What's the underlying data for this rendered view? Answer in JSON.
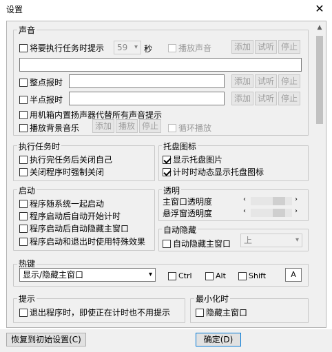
{
  "window": {
    "title": "设置",
    "close_glyph": "✕"
  },
  "sound": {
    "title": "声音",
    "task_prompt_label": "将要执行任务时提示",
    "task_prompt_seconds": "59",
    "seconds_unit": "秒",
    "play_sound_label": "播放声音",
    "add": "添加",
    "listen": "试听",
    "stop": "停止",
    "on_hour_label": "整点报时",
    "half_hour_label": "半点报时",
    "internal_speaker_label": "用机箱内置扬声器代替所有声音提示",
    "bg_music_label": "播放背景音乐",
    "play": "播放",
    "loop_label": "循环播放"
  },
  "task": {
    "title": "执行任务时",
    "close_self_label": "执行完任务后关闭自己",
    "force_close_label": "关闭程序时强制关闭"
  },
  "tray": {
    "title": "托盘图标",
    "show_tray_label": "显示托盘图片",
    "dynamic_tray_label": "计时时动态显示托盘图标"
  },
  "startup": {
    "title": "启动",
    "with_system_label": "程序随系统一起启动",
    "auto_start_timer_label": "程序启动后自动开始计时",
    "auto_hide_label": "程序启动后自动隐藏主窗口",
    "effects_label": "程序启动和退出时使用特殊效果"
  },
  "transparency": {
    "title": "透明",
    "main_label": "主窗口透明度",
    "float_label": "悬浮窗透明度",
    "main_value": 0.75,
    "float_value": 0.75
  },
  "autohide": {
    "title": "自动隐藏",
    "hide_main_label": "自动隐藏主窗口",
    "position_value": "上"
  },
  "hotkey": {
    "title": "热键",
    "action_value": "显示/隐藏主窗口",
    "ctrl": "Ctrl",
    "alt": "Alt",
    "shift": "Shift",
    "key_value": "A"
  },
  "tip": {
    "title": "提示",
    "exit_label": "退出程序时，即使正在计时也不用提示"
  },
  "minimize": {
    "title": "最小化时",
    "hide_main_label": "隐藏主窗口"
  },
  "footer": {
    "restore_label": "恢复到初始设置(C)",
    "ok_label": "确定(D)"
  }
}
